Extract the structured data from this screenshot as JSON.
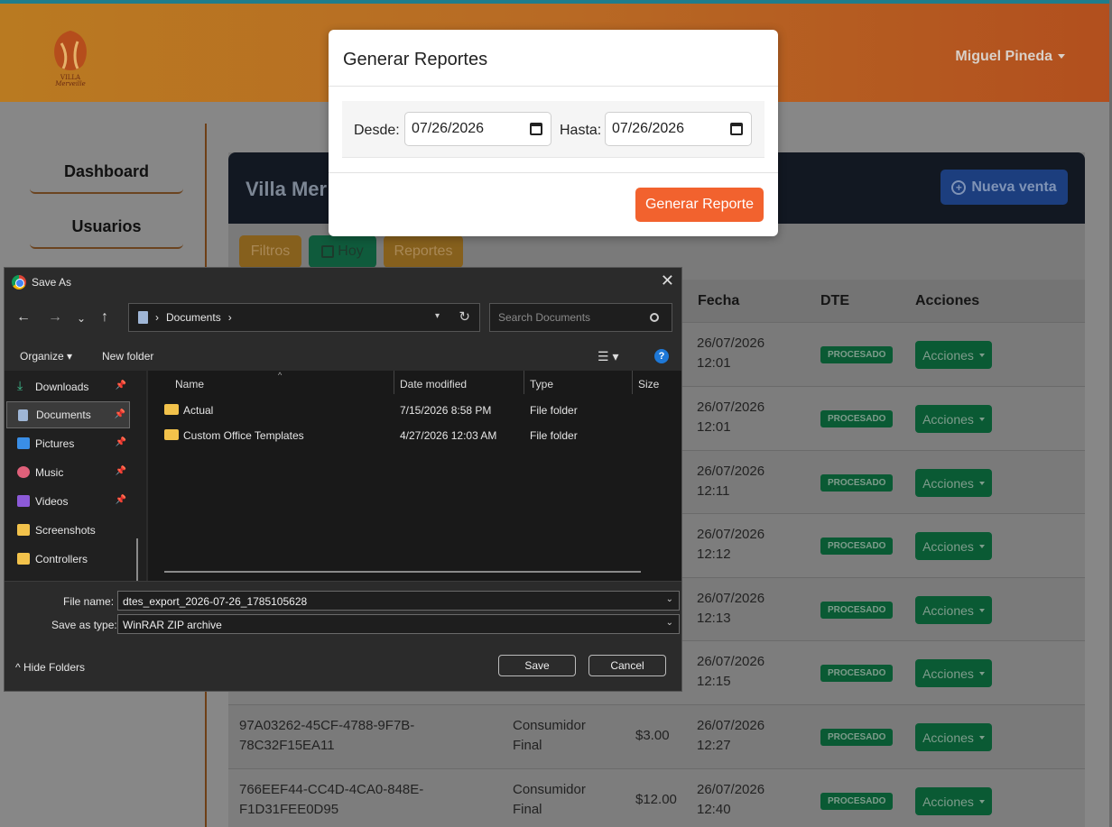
{
  "header": {
    "logo_text": "Villa Merveille",
    "user_name": "Miguel Pineda"
  },
  "sidebar": {
    "items": [
      {
        "label": "Dashboard"
      },
      {
        "label": "Usuarios"
      }
    ]
  },
  "card": {
    "title": "Villa Mer",
    "new_sale_label": "Nueva venta",
    "filters": {
      "filtros": "Filtros",
      "hoy": "Hoy",
      "reportes": "Reportes"
    },
    "columns": {
      "fecha": "Fecha",
      "dte": "DTE",
      "acciones": "Acciones"
    },
    "rows": [
      {
        "uuid": "",
        "tipo": "",
        "monto": "",
        "fecha": "26/07/2026 12:01",
        "dte": "PROCESADO",
        "accion": "Acciones"
      },
      {
        "uuid": "",
        "tipo": "",
        "monto": "",
        "fecha": "26/07/2026 12:01",
        "dte": "PROCESADO",
        "accion": "Acciones"
      },
      {
        "uuid": "",
        "tipo": "",
        "monto": "",
        "fecha": "26/07/2026 12:11",
        "dte": "PROCESADO",
        "accion": "Acciones"
      },
      {
        "uuid": "",
        "tipo": "",
        "monto": "",
        "fecha": "26/07/2026 12:12",
        "dte": "PROCESADO",
        "accion": "Acciones"
      },
      {
        "uuid": "",
        "tipo": "",
        "monto": "",
        "fecha": "26/07/2026 12:13",
        "dte": "PROCESADO",
        "accion": "Acciones"
      },
      {
        "uuid": "",
        "tipo": "",
        "monto": "",
        "fecha": "26/07/2026 12:15",
        "dte": "PROCESADO",
        "accion": "Acciones"
      },
      {
        "uuid": "97A03262-45CF-4788-9F7B-78C32F15EA11",
        "tipo": "Consumidor Final",
        "monto": "$3.00",
        "fecha": "26/07/2026 12:27",
        "dte": "PROCESADO",
        "accion": "Acciones"
      },
      {
        "uuid": "766EEF44-CC4D-4CA0-848E-F1D31FEE0D95",
        "tipo": "Consumidor Final",
        "monto": "$12.00",
        "fecha": "26/07/2026 12:40",
        "dte": "PROCESADO",
        "accion": "Acciones"
      }
    ]
  },
  "modal": {
    "title": "Generar Reportes",
    "desde_label": "Desde:",
    "desde_value": "07/26/2026",
    "hasta_label": "Hasta:",
    "hasta_value": "07/26/2026",
    "submit_label": "Generar Reporte"
  },
  "save_dialog": {
    "title": "Save As",
    "address": "Documents",
    "search_placeholder": "Search Documents",
    "organize": "Organize",
    "new_folder": "New folder",
    "nav_items": [
      {
        "label": "Downloads",
        "icon": "download-icon",
        "pinned": true
      },
      {
        "label": "Documents",
        "icon": "documents-icon",
        "pinned": true
      },
      {
        "label": "Pictures",
        "icon": "pictures-icon",
        "pinned": true
      },
      {
        "label": "Music",
        "icon": "music-icon",
        "pinned": true
      },
      {
        "label": "Videos",
        "icon": "videos-icon",
        "pinned": true
      },
      {
        "label": "Screenshots",
        "icon": "folder-icon",
        "pinned": false
      },
      {
        "label": "Controllers",
        "icon": "folder-icon",
        "pinned": false
      }
    ],
    "columns": {
      "name": "Name",
      "date": "Date modified",
      "type": "Type",
      "size": "Size"
    },
    "files": [
      {
        "name": "Actual",
        "date": "7/15/2026 8:58 PM",
        "type": "File folder"
      },
      {
        "name": "Custom Office Templates",
        "date": "4/27/2026 12:03 AM",
        "type": "File folder"
      }
    ],
    "file_name_label": "File name:",
    "file_name": "dtes_export_2026-07-26_1785105628",
    "save_type_label": "Save as type:",
    "save_type": "WinRAR ZIP archive",
    "save_label": "Save",
    "cancel_label": "Cancel",
    "hide_folders_label": "Hide Folders"
  }
}
